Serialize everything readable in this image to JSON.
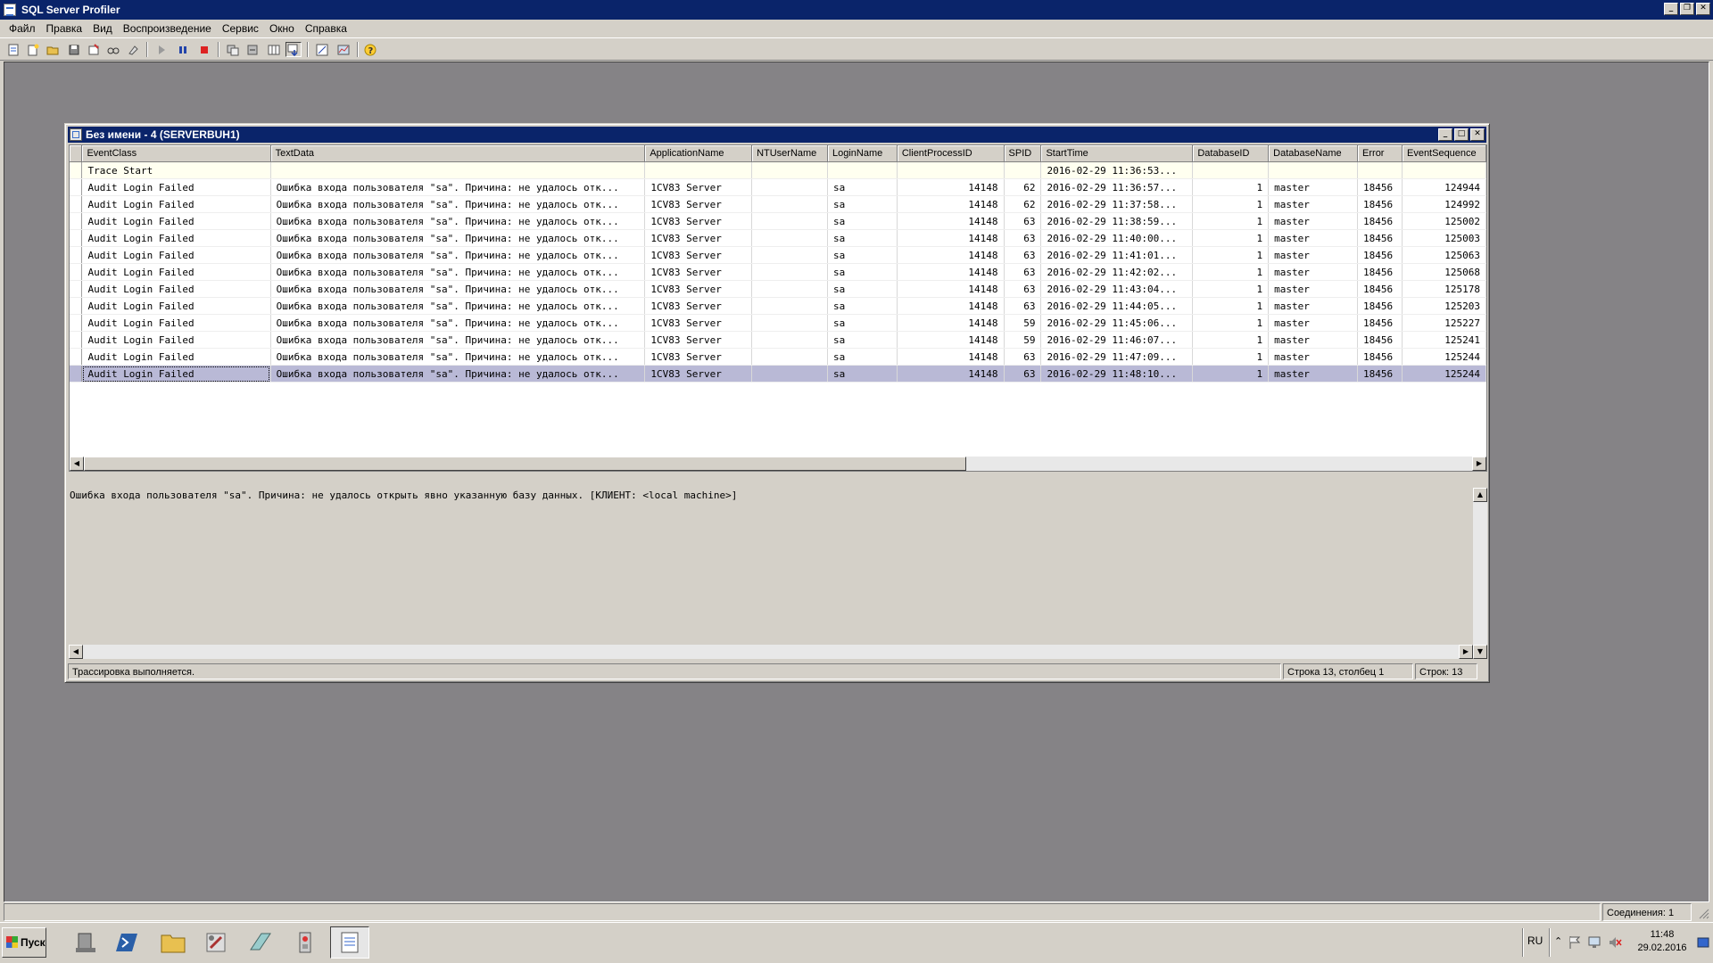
{
  "app": {
    "title": "SQL Server Profiler"
  },
  "menu": [
    "Файл",
    "Правка",
    "Вид",
    "Воспроизведение",
    "Сервис",
    "Окно",
    "Справка"
  ],
  "toolbar": {
    "icons": [
      "new-trace-icon",
      "new-template-icon",
      "open-icon",
      "save-icon",
      "properties-icon",
      "find-icon",
      "clear-trace-icon",
      "run-trace-icon",
      "pause-trace-icon",
      "stop-trace-icon",
      "replay-icon",
      "replay-step-icon",
      "column-chooser-icon",
      "auto-scroll-icon",
      "database-tuning-advisor-icon",
      "performance-monitor-icon",
      "help-icon"
    ]
  },
  "child": {
    "title": "Без имени - 4 (SERVERBUH1)"
  },
  "grid": {
    "columns": [
      "EventClass",
      "TextData",
      "ApplicationName",
      "NTUserName",
      "LoginName",
      "ClientProcessID",
      "SPID",
      "StartTime",
      "DatabaseID",
      "DatabaseName",
      "Error",
      "EventSequence"
    ],
    "trace_start": {
      "event": "Trace Start",
      "start_time": "2016-02-29 11:36:53..."
    },
    "rows": [
      {
        "event": "Audit Login Failed",
        "text": "Ошибка входа пользователя \"sa\". Причина: не удалось отк...",
        "app": "1CV83 Server",
        "nt": "",
        "login": "sa",
        "cpid": "14148",
        "spid": "62",
        "start": "2016-02-29 11:36:57...",
        "dbid": "1",
        "dbname": "master",
        "error": "18456",
        "seq": "124944"
      },
      {
        "event": "Audit Login Failed",
        "text": "Ошибка входа пользователя \"sa\". Причина: не удалось отк...",
        "app": "1CV83 Server",
        "nt": "",
        "login": "sa",
        "cpid": "14148",
        "spid": "62",
        "start": "2016-02-29 11:37:58...",
        "dbid": "1",
        "dbname": "master",
        "error": "18456",
        "seq": "124992"
      },
      {
        "event": "Audit Login Failed",
        "text": "Ошибка входа пользователя \"sa\". Причина: не удалось отк...",
        "app": "1CV83 Server",
        "nt": "",
        "login": "sa",
        "cpid": "14148",
        "spid": "63",
        "start": "2016-02-29 11:38:59...",
        "dbid": "1",
        "dbname": "master",
        "error": "18456",
        "seq": "125002"
      },
      {
        "event": "Audit Login Failed",
        "text": "Ошибка входа пользователя \"sa\". Причина: не удалось отк...",
        "app": "1CV83 Server",
        "nt": "",
        "login": "sa",
        "cpid": "14148",
        "spid": "63",
        "start": "2016-02-29 11:40:00...",
        "dbid": "1",
        "dbname": "master",
        "error": "18456",
        "seq": "125003"
      },
      {
        "event": "Audit Login Failed",
        "text": "Ошибка входа пользователя \"sa\". Причина: не удалось отк...",
        "app": "1CV83 Server",
        "nt": "",
        "login": "sa",
        "cpid": "14148",
        "spid": "63",
        "start": "2016-02-29 11:41:01...",
        "dbid": "1",
        "dbname": "master",
        "error": "18456",
        "seq": "125063"
      },
      {
        "event": "Audit Login Failed",
        "text": "Ошибка входа пользователя \"sa\". Причина: не удалось отк...",
        "app": "1CV83 Server",
        "nt": "",
        "login": "sa",
        "cpid": "14148",
        "spid": "63",
        "start": "2016-02-29 11:42:02...",
        "dbid": "1",
        "dbname": "master",
        "error": "18456",
        "seq": "125068"
      },
      {
        "event": "Audit Login Failed",
        "text": "Ошибка входа пользователя \"sa\". Причина: не удалось отк...",
        "app": "1CV83 Server",
        "nt": "",
        "login": "sa",
        "cpid": "14148",
        "spid": "63",
        "start": "2016-02-29 11:43:04...",
        "dbid": "1",
        "dbname": "master",
        "error": "18456",
        "seq": "125178"
      },
      {
        "event": "Audit Login Failed",
        "text": "Ошибка входа пользователя \"sa\". Причина: не удалось отк...",
        "app": "1CV83 Server",
        "nt": "",
        "login": "sa",
        "cpid": "14148",
        "spid": "63",
        "start": "2016-02-29 11:44:05...",
        "dbid": "1",
        "dbname": "master",
        "error": "18456",
        "seq": "125203"
      },
      {
        "event": "Audit Login Failed",
        "text": "Ошибка входа пользователя \"sa\". Причина: не удалось отк...",
        "app": "1CV83 Server",
        "nt": "",
        "login": "sa",
        "cpid": "14148",
        "spid": "59",
        "start": "2016-02-29 11:45:06...",
        "dbid": "1",
        "dbname": "master",
        "error": "18456",
        "seq": "125227"
      },
      {
        "event": "Audit Login Failed",
        "text": "Ошибка входа пользователя \"sa\". Причина: не удалось отк...",
        "app": "1CV83 Server",
        "nt": "",
        "login": "sa",
        "cpid": "14148",
        "spid": "59",
        "start": "2016-02-29 11:46:07...",
        "dbid": "1",
        "dbname": "master",
        "error": "18456",
        "seq": "125241"
      },
      {
        "event": "Audit Login Failed",
        "text": "Ошибка входа пользователя \"sa\". Причина: не удалось отк...",
        "app": "1CV83 Server",
        "nt": "",
        "login": "sa",
        "cpid": "14148",
        "spid": "63",
        "start": "2016-02-29 11:47:09...",
        "dbid": "1",
        "dbname": "master",
        "error": "18456",
        "seq": "125244"
      },
      {
        "event": "Audit Login Failed",
        "text": "Ошибка входа пользователя \"sa\". Причина: не удалось отк...",
        "app": "1CV83 Server",
        "nt": "",
        "login": "sa",
        "cpid": "14148",
        "spid": "63",
        "start": "2016-02-29 11:48:10...",
        "dbid": "1",
        "dbname": "master",
        "error": "18456",
        "seq": "125244"
      }
    ]
  },
  "detail": {
    "text": "Ошибка входа пользователя \"sa\". Причина: не удалось открыть явно указанную базу данных. [КЛИЕНТ: <local machine>]"
  },
  "child_status": {
    "message": "Трассировка выполняется.",
    "position": "Строка 13, столбец 1",
    "rows": "Строк: 13"
  },
  "app_status": {
    "connections": "Соединения: 1"
  },
  "taskbar": {
    "start": "Пуск",
    "apps": [
      "server-manager-icon",
      "powershell-icon",
      "file-explorer-icon",
      "sql-tools-icon",
      "management-studio-icon",
      "services-icon",
      "profiler-icon"
    ],
    "lang": "RU",
    "time": "11:48",
    "date": "29.02.2016"
  },
  "colors": {
    "titlebar": "#0a246a",
    "workspace": "#858386",
    "selected_row": "#b9b9d6"
  }
}
